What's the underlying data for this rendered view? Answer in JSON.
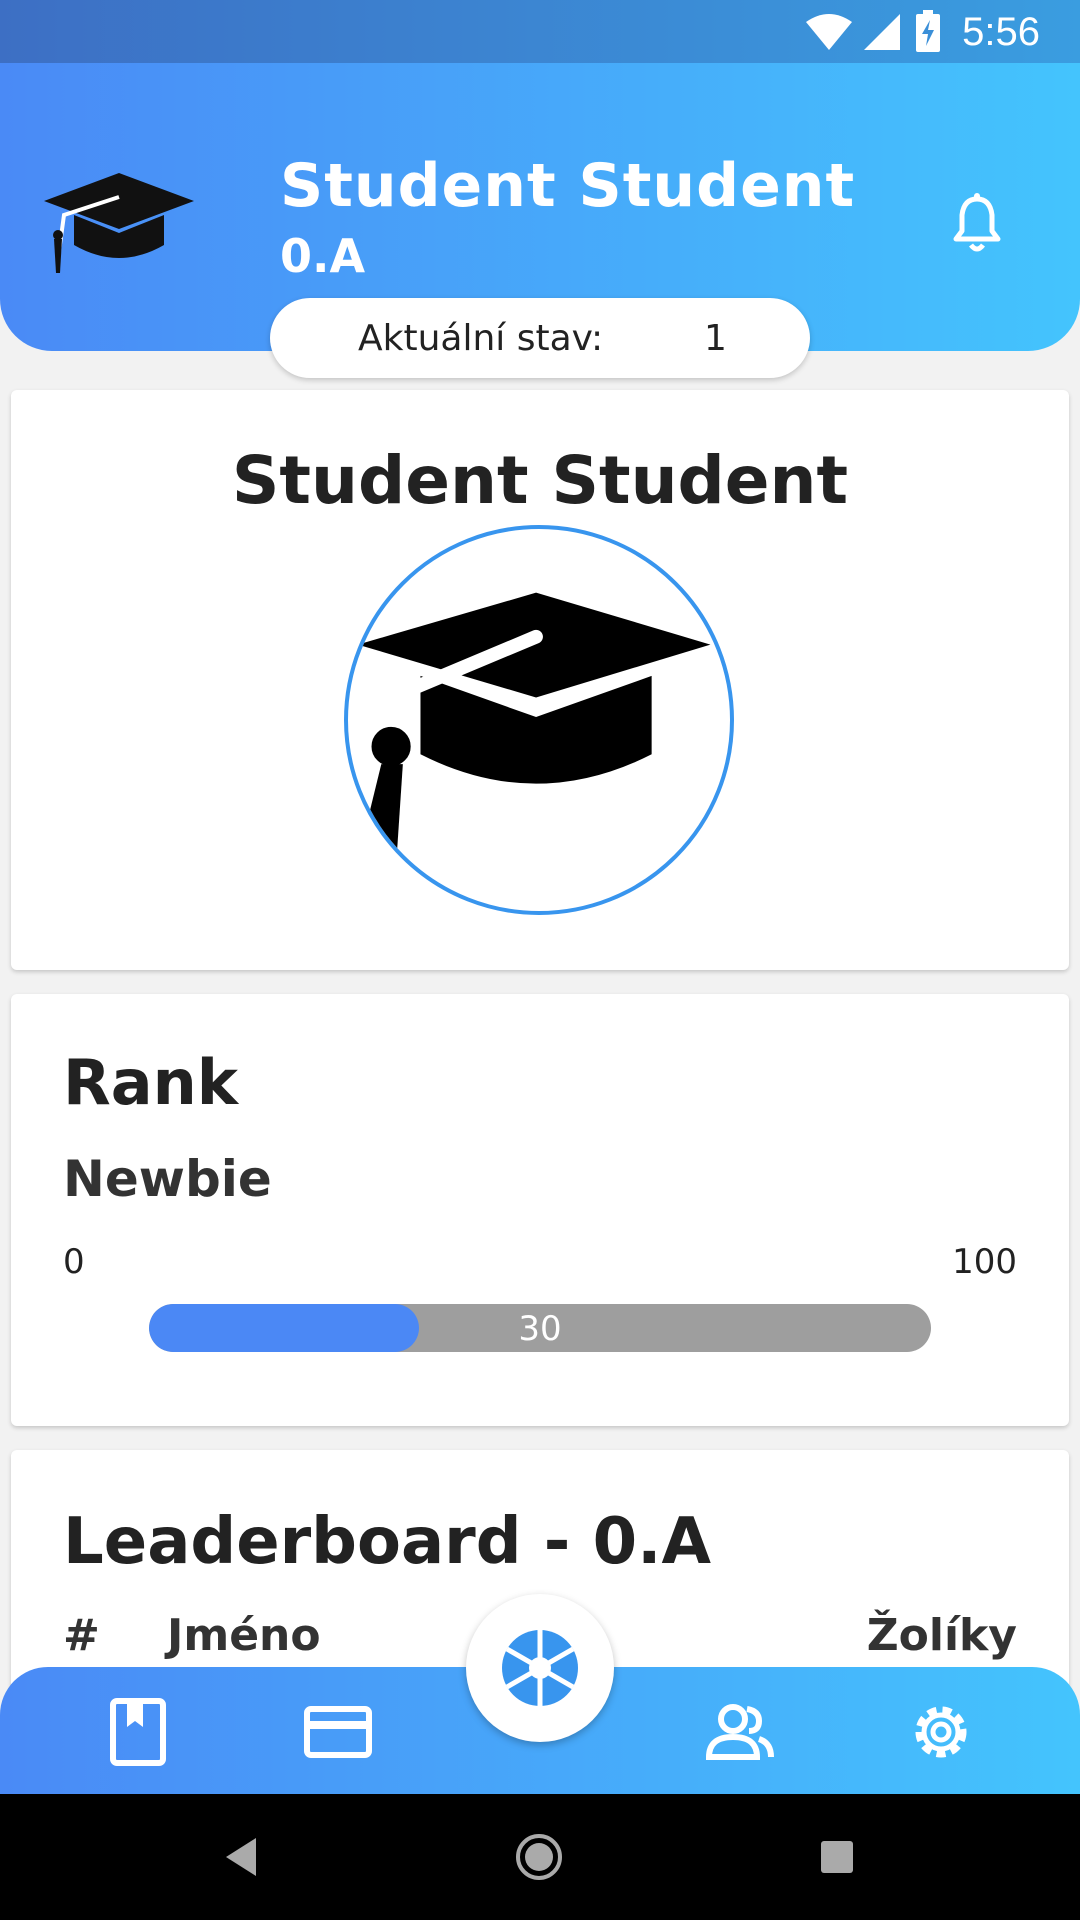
{
  "status_bar": {
    "time": "5:56"
  },
  "header": {
    "student_name": "Student Student",
    "class_name": "0.A"
  },
  "status_pill": {
    "label": "Aktuální stav:",
    "value": "1"
  },
  "profile_card": {
    "name": "Student Student"
  },
  "rank_card": {
    "title": "Rank",
    "rank_name": "Newbie",
    "min_label": "0",
    "max_label": "100",
    "progress_value": 30,
    "progress_text": "30"
  },
  "leaderboard_card": {
    "title": "Leaderboard - 0.A",
    "columns": {
      "number": "#",
      "name": "Jméno",
      "jokers": "Žolíky"
    }
  },
  "bottom_nav": {
    "items": [
      "book-icon",
      "card-icon",
      "camera-shutter-icon",
      "people-icon",
      "settings-icon"
    ]
  },
  "colors": {
    "accent_start": "#4a8af6",
    "accent_end": "#44c4fd",
    "progress_fill": "#4b88f5",
    "avatar_ring": "#3895ee"
  }
}
